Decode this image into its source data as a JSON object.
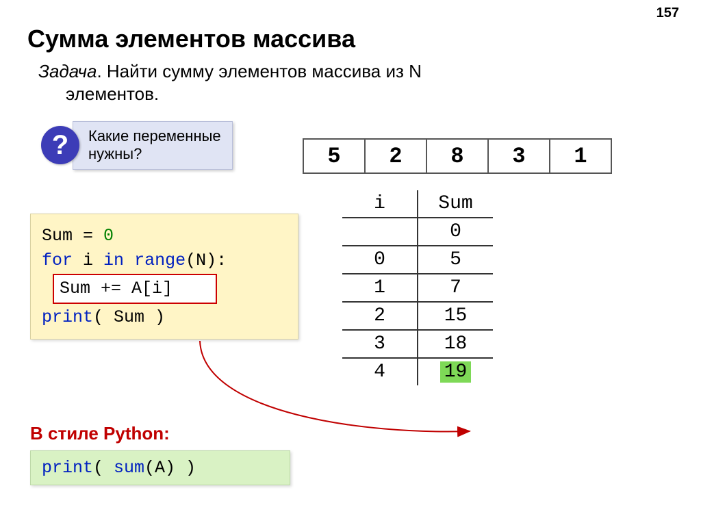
{
  "page_number": "157",
  "title": "Сумма элементов массива",
  "task_label": "Задача",
  "task_text": ". Найти сумму элементов массива из N",
  "task_text2": "элементов.",
  "question_mark": "?",
  "question_text_l1": "Какие переменные",
  "question_text_l2": "нужны?",
  "array": [
    "5",
    "2",
    "8",
    "3",
    "1"
  ],
  "code": {
    "l1_a": "Sum = ",
    "l1_b": "0",
    "l2_a": "for",
    "l2_b": " i ",
    "l2_c": "in",
    "l2_d": " ",
    "l2_e": "range",
    "l2_f": "(N):",
    "l3": "Sum += A[i]",
    "l4_a": "print",
    "l4_b": "( Sum )"
  },
  "trace": {
    "head_i": "i",
    "head_sum": "Sum",
    "rows": [
      {
        "i": "",
        "sum": "0"
      },
      {
        "i": "0",
        "sum": "5"
      },
      {
        "i": "1",
        "sum": "7"
      },
      {
        "i": "2",
        "sum": "15"
      },
      {
        "i": "3",
        "sum": "18"
      },
      {
        "i": "4",
        "sum": "19"
      }
    ]
  },
  "python_style_label": "В стиле Python:",
  "code2_a": "print",
  "code2_b": "( ",
  "code2_c": "sum",
  "code2_d": "(A) )"
}
